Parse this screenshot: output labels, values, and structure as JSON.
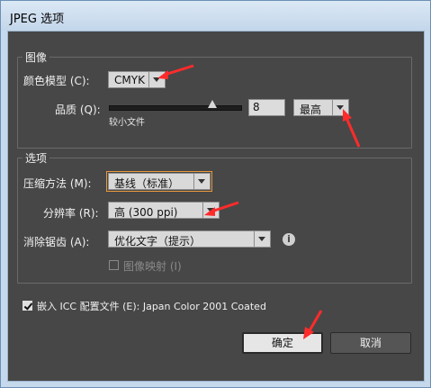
{
  "window": {
    "title": "JPEG 选项"
  },
  "image_group": {
    "legend": "图像",
    "color_model_label": "颜色模型 (C):",
    "color_model_value": "CMYK",
    "quality_label": "品质 (Q):",
    "quality_value": "8",
    "quality_hint": "较小文件",
    "quality_preset": "最高",
    "quality_slider_fraction": 0.8
  },
  "options_group": {
    "legend": "选项",
    "compression_label": "压缩方法 (M):",
    "compression_value": "基线（标准）",
    "resolution_label": "分辨率 (R):",
    "resolution_value": "高 (300 ppi)",
    "antialias_label": "消除锯齿 (A):",
    "antialias_value": "优化文字（提示）",
    "info_icon_text": "i",
    "imagemap_label": "图像映射 (I)"
  },
  "embed": {
    "label": "嵌入 ICC 配置文件 (E): Japan Color 2001 Coated",
    "checked": true
  },
  "buttons": {
    "ok": "确定",
    "cancel": "取消"
  },
  "colors": {
    "panel": "#474747",
    "focus": "#e8993b",
    "annotation_arrow": "#ff2b2b"
  }
}
